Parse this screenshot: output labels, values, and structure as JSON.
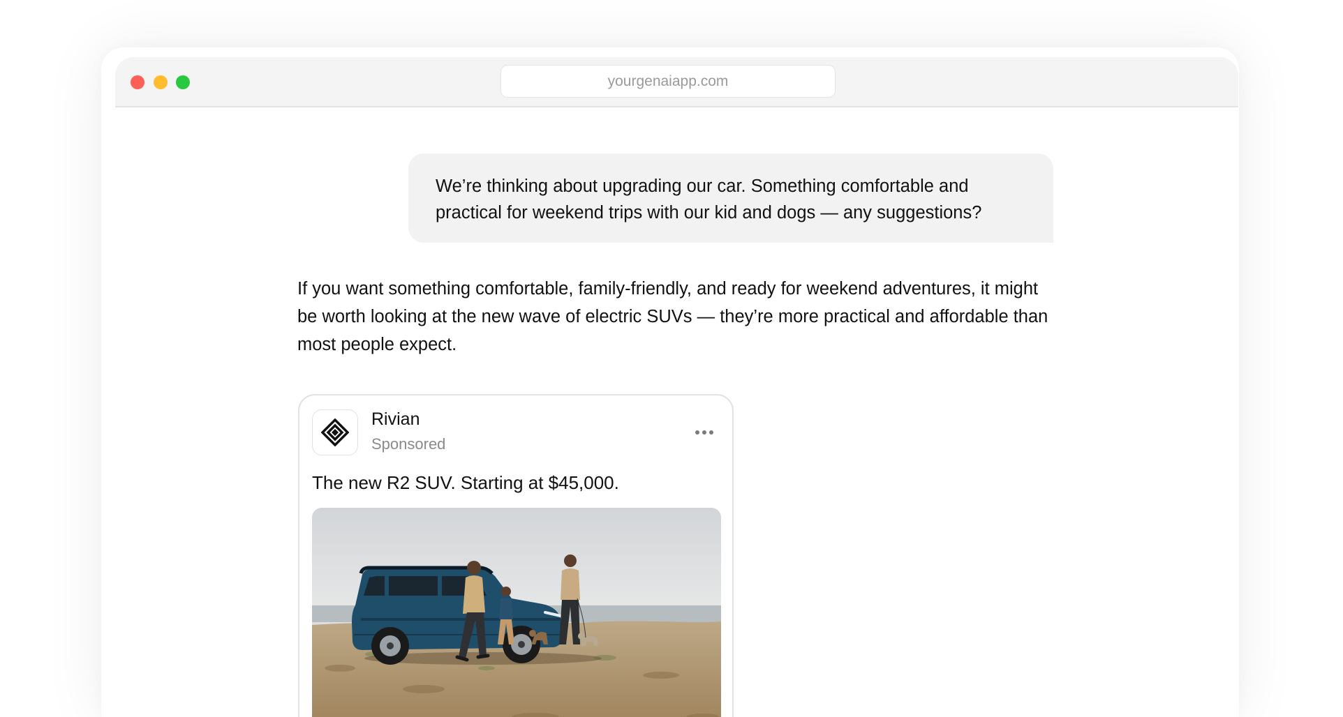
{
  "browser": {
    "url": "yourgenaiapp.com",
    "traffic_lights": [
      "close",
      "minimize",
      "maximize"
    ]
  },
  "chat": {
    "user_message": "We’re thinking about upgrading our car. Something comfortable and practical for weekend trips with our kid and dogs — any suggestions?",
    "assistant_message": "If you want something comfortable, family-friendly, and ready for weekend adventures, it might be worth looking at the new wave of electric SUVs — they’re more practical and affordable than most people expect."
  },
  "ad": {
    "brand": "Rivian",
    "label": "Sponsored",
    "headline": "The new R2 SUV. Starting at $45,000.",
    "logo_icon": "rivian-diamond-logo",
    "more_icon": "more-dots-icon",
    "image": "blue-electric-suv-family-beach-photo"
  },
  "colors": {
    "close": "#fe5f57",
    "minimize": "#febc2e",
    "maximize": "#28c840",
    "suv_body": "#1f4e6b",
    "bubble_bg": "#f2f2f2"
  }
}
